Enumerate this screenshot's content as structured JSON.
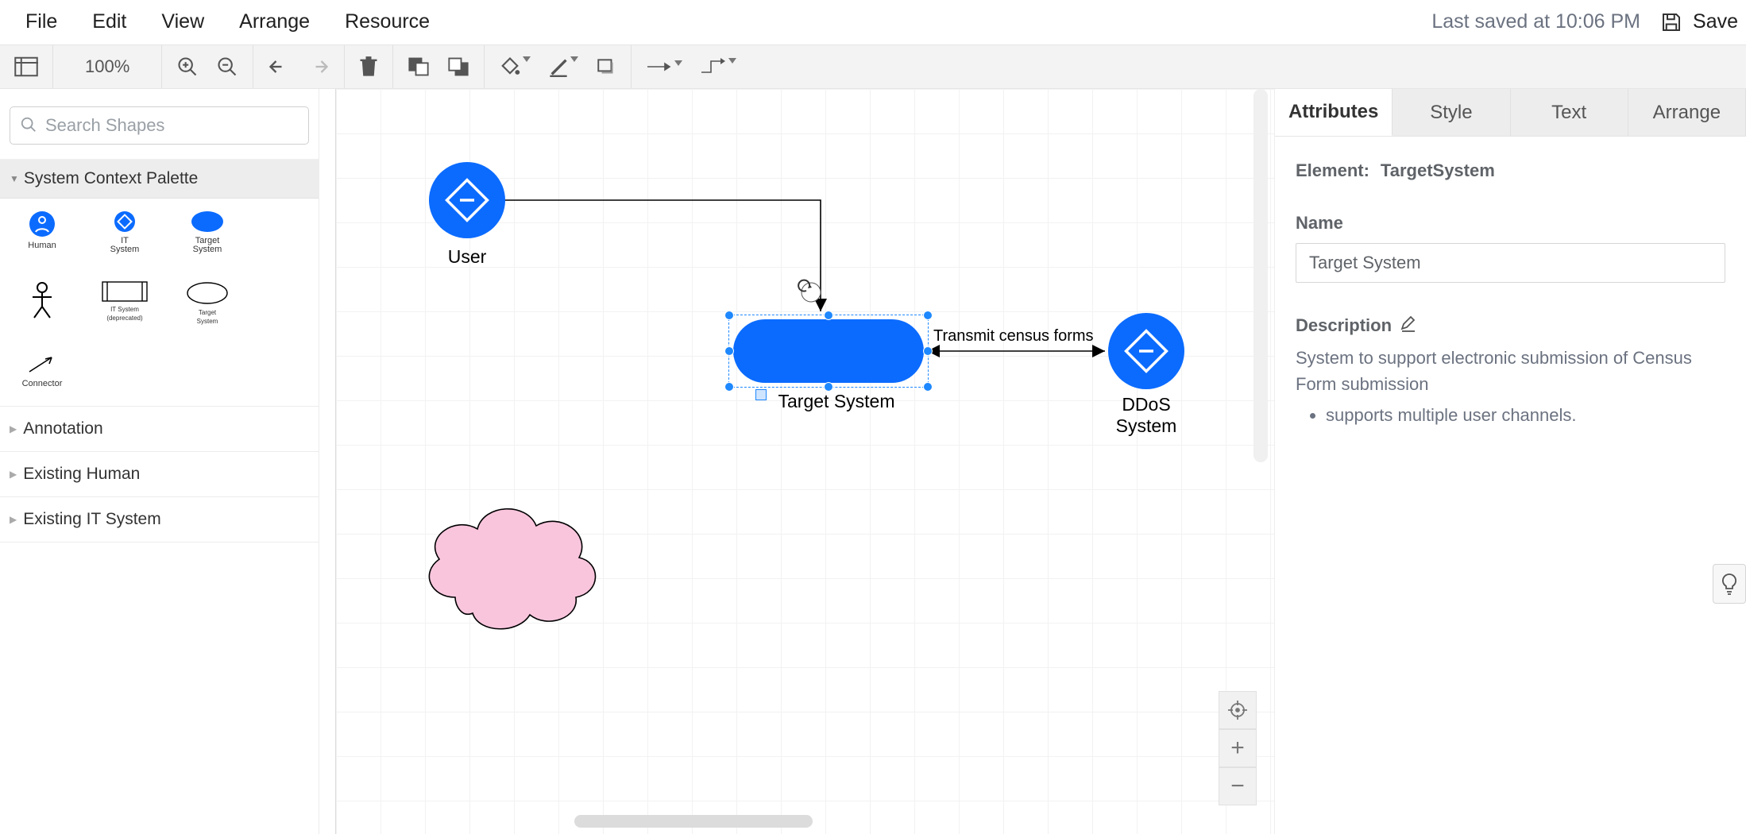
{
  "menubar": {
    "items": [
      "File",
      "Edit",
      "View",
      "Arrange",
      "Resource"
    ]
  },
  "header": {
    "last_saved": "Last saved at 10:06 PM",
    "save": "Save"
  },
  "toolbar": {
    "zoom": "100%"
  },
  "left": {
    "search_placeholder": "Search Shapes",
    "palette_title": "System Context Palette",
    "palette_items": [
      {
        "label1": "Human"
      },
      {
        "label1": "IT",
        "label2": "System"
      },
      {
        "label1": "Target",
        "label2": "System"
      },
      {
        "label1": ""
      },
      {
        "label1": "IT System",
        "label2": "(deprecated)"
      },
      {
        "label1": "Target",
        "label2": "System"
      },
      {
        "label1": "Connector"
      }
    ],
    "sections": [
      "Annotation",
      "Existing Human",
      "Existing IT System"
    ]
  },
  "canvas": {
    "nodes": {
      "user": "User",
      "target_system": "Target System",
      "ddos": "DDoS",
      "ddos_line2": "System"
    },
    "edges": {
      "transmit": "Transmit census forms"
    }
  },
  "right": {
    "tabs": [
      "Attributes",
      "Style",
      "Text",
      "Arrange"
    ],
    "element_label": "Element:",
    "element_value": "TargetSystem",
    "name_label": "Name",
    "name_value": "Target System",
    "description_label": "Description",
    "description_text": "System to support electronic submission of Census Form submission",
    "description_bullet": "supports multiple user channels."
  },
  "colors": {
    "accent": "#0b6bff",
    "blue": "#0b6bff",
    "pink": "#f9c5dd"
  }
}
